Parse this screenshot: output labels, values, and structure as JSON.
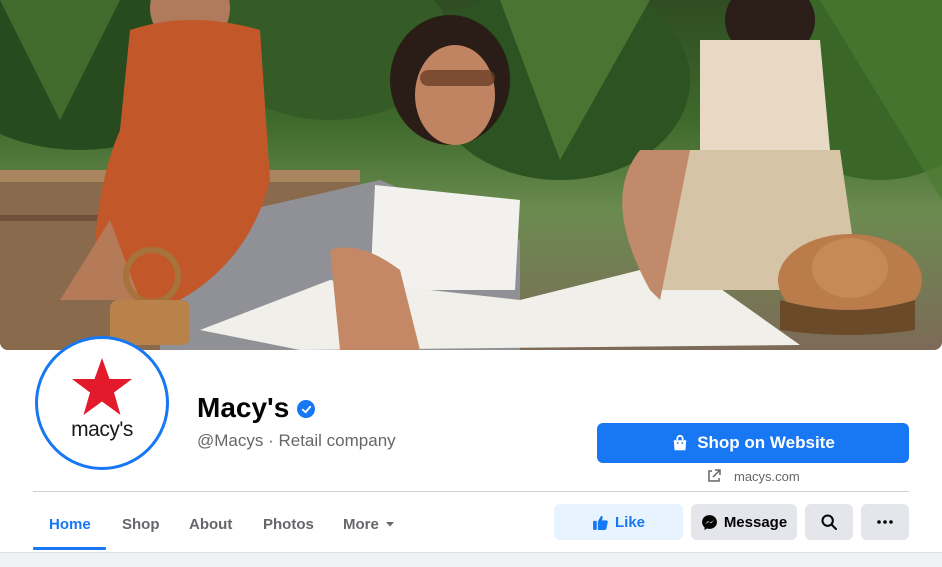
{
  "page": {
    "name": "Macy's",
    "subtitle": "@Macys · Retail company",
    "verified": true,
    "logo_text": "macy's",
    "logo_star_color": "#e21a2c"
  },
  "cta": {
    "shop_label": "Shop on Website",
    "website": "macys.com"
  },
  "tabs": [
    {
      "label": "Home",
      "active": true
    },
    {
      "label": "Shop",
      "active": false
    },
    {
      "label": "About",
      "active": false
    },
    {
      "label": "Photos",
      "active": false
    },
    {
      "label": "More",
      "active": false,
      "has_dropdown": true
    }
  ],
  "actions": {
    "like_label": "Like",
    "message_label": "Message",
    "search_icon": "search-icon",
    "more_icon": "ellipsis-icon"
  },
  "colors": {
    "accent": "#1877f2",
    "secondary_text": "#65676b",
    "button_gray": "#e4e6eb",
    "like_bg": "#e7f3ff"
  }
}
